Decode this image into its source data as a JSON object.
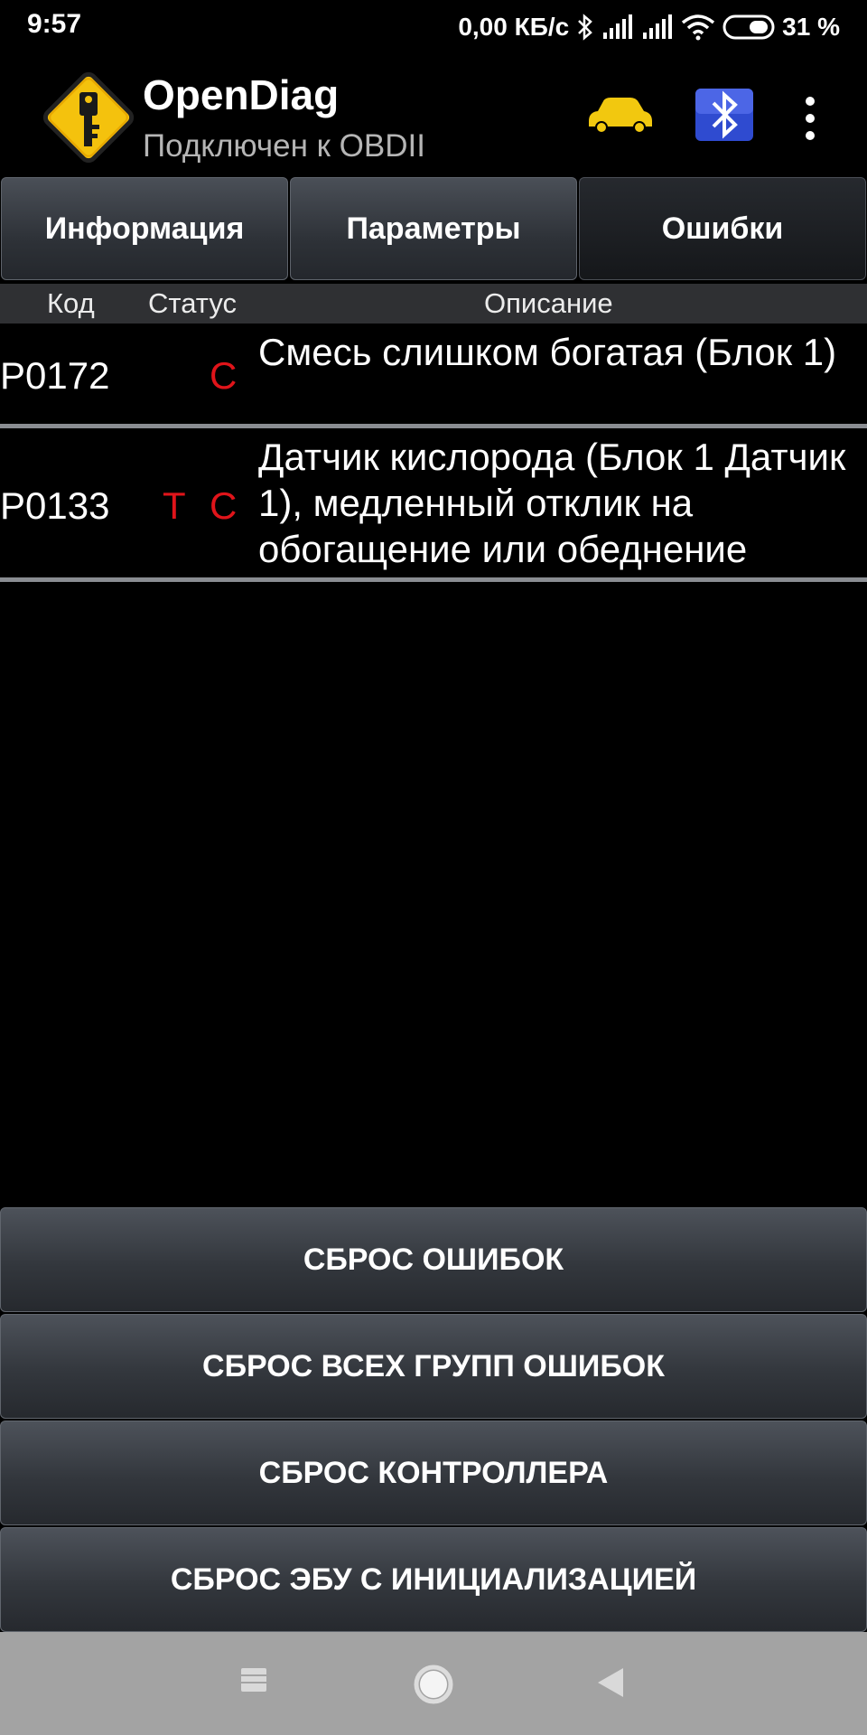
{
  "status_bar": {
    "time": "9:57",
    "network_speed": "0,00 КБ/с",
    "battery": "31 %",
    "icons": [
      "bluetooth-icon",
      "signal-icon",
      "signal-icon",
      "wifi-icon",
      "battery-icon"
    ]
  },
  "app_bar": {
    "title": "OpenDiag",
    "subtitle": "Подключен к OBDII",
    "icons": [
      "app-logo-icon",
      "car-icon",
      "bluetooth-adapter-icon",
      "more-vert-icon"
    ],
    "colors": {
      "car": "#f2c80f",
      "logo": "#f4c20d",
      "bluetooth": "#2f4bd0"
    }
  },
  "tabs": [
    {
      "label": "Информация",
      "active": false
    },
    {
      "label": "Параметры",
      "active": false
    },
    {
      "label": "Ошибки",
      "active": true
    }
  ],
  "table": {
    "headers": {
      "code": "Код",
      "status": "Статус",
      "description": "Описание"
    },
    "rows": [
      {
        "code": "P0172",
        "status_t": "",
        "status_c": "C",
        "description": "Смесь слишком богатая (Блок 1)"
      },
      {
        "code": "P0133",
        "status_t": "T",
        "status_c": "C",
        "description": "Датчик кислорода (Блок 1 Датчик 1), медленный отклик на обогащение или обеднение"
      }
    ],
    "status_color": "#e0141a"
  },
  "actions": {
    "reset_errors": "СБРОС ОШИБОК",
    "reset_all_groups": "СБРОС ВСЕХ ГРУПП ОШИБОК",
    "reset_controller": "СБРОС КОНТРОЛЛЕРА",
    "reset_ecu_init": "СБРОС ЭБУ С ИНИЦИАЛИЗАЦИЕЙ"
  },
  "nav_bar": {
    "icons": [
      "recents-icon",
      "home-icon",
      "back-icon"
    ]
  }
}
